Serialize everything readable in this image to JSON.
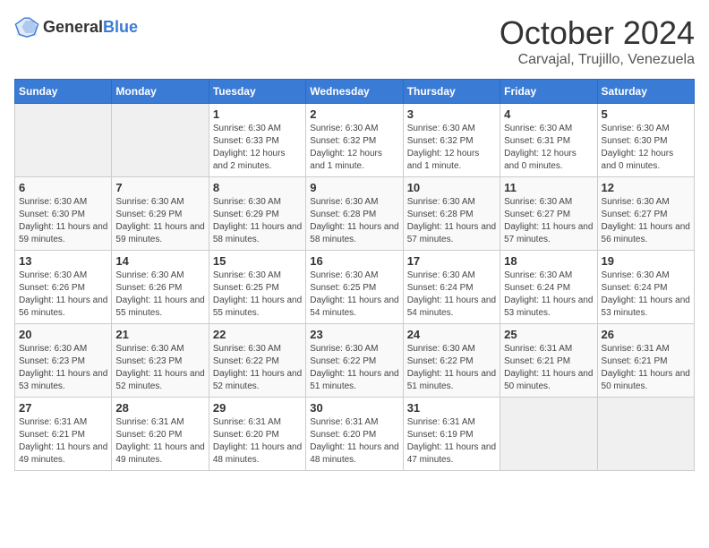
{
  "header": {
    "logo_general": "General",
    "logo_blue": "Blue",
    "month_title": "October 2024",
    "location": "Carvajal, Trujillo, Venezuela"
  },
  "days_of_week": [
    "Sunday",
    "Monday",
    "Tuesday",
    "Wednesday",
    "Thursday",
    "Friday",
    "Saturday"
  ],
  "weeks": [
    [
      {
        "day": "",
        "info": ""
      },
      {
        "day": "",
        "info": ""
      },
      {
        "day": "1",
        "info": "Sunrise: 6:30 AM\nSunset: 6:33 PM\nDaylight: 12 hours and 2 minutes."
      },
      {
        "day": "2",
        "info": "Sunrise: 6:30 AM\nSunset: 6:32 PM\nDaylight: 12 hours and 1 minute."
      },
      {
        "day": "3",
        "info": "Sunrise: 6:30 AM\nSunset: 6:32 PM\nDaylight: 12 hours and 1 minute."
      },
      {
        "day": "4",
        "info": "Sunrise: 6:30 AM\nSunset: 6:31 PM\nDaylight: 12 hours and 0 minutes."
      },
      {
        "day": "5",
        "info": "Sunrise: 6:30 AM\nSunset: 6:30 PM\nDaylight: 12 hours and 0 minutes."
      }
    ],
    [
      {
        "day": "6",
        "info": "Sunrise: 6:30 AM\nSunset: 6:30 PM\nDaylight: 11 hours and 59 minutes."
      },
      {
        "day": "7",
        "info": "Sunrise: 6:30 AM\nSunset: 6:29 PM\nDaylight: 11 hours and 59 minutes."
      },
      {
        "day": "8",
        "info": "Sunrise: 6:30 AM\nSunset: 6:29 PM\nDaylight: 11 hours and 58 minutes."
      },
      {
        "day": "9",
        "info": "Sunrise: 6:30 AM\nSunset: 6:28 PM\nDaylight: 11 hours and 58 minutes."
      },
      {
        "day": "10",
        "info": "Sunrise: 6:30 AM\nSunset: 6:28 PM\nDaylight: 11 hours and 57 minutes."
      },
      {
        "day": "11",
        "info": "Sunrise: 6:30 AM\nSunset: 6:27 PM\nDaylight: 11 hours and 57 minutes."
      },
      {
        "day": "12",
        "info": "Sunrise: 6:30 AM\nSunset: 6:27 PM\nDaylight: 11 hours and 56 minutes."
      }
    ],
    [
      {
        "day": "13",
        "info": "Sunrise: 6:30 AM\nSunset: 6:26 PM\nDaylight: 11 hours and 56 minutes."
      },
      {
        "day": "14",
        "info": "Sunrise: 6:30 AM\nSunset: 6:26 PM\nDaylight: 11 hours and 55 minutes."
      },
      {
        "day": "15",
        "info": "Sunrise: 6:30 AM\nSunset: 6:25 PM\nDaylight: 11 hours and 55 minutes."
      },
      {
        "day": "16",
        "info": "Sunrise: 6:30 AM\nSunset: 6:25 PM\nDaylight: 11 hours and 54 minutes."
      },
      {
        "day": "17",
        "info": "Sunrise: 6:30 AM\nSunset: 6:24 PM\nDaylight: 11 hours and 54 minutes."
      },
      {
        "day": "18",
        "info": "Sunrise: 6:30 AM\nSunset: 6:24 PM\nDaylight: 11 hours and 53 minutes."
      },
      {
        "day": "19",
        "info": "Sunrise: 6:30 AM\nSunset: 6:24 PM\nDaylight: 11 hours and 53 minutes."
      }
    ],
    [
      {
        "day": "20",
        "info": "Sunrise: 6:30 AM\nSunset: 6:23 PM\nDaylight: 11 hours and 53 minutes."
      },
      {
        "day": "21",
        "info": "Sunrise: 6:30 AM\nSunset: 6:23 PM\nDaylight: 11 hours and 52 minutes."
      },
      {
        "day": "22",
        "info": "Sunrise: 6:30 AM\nSunset: 6:22 PM\nDaylight: 11 hours and 52 minutes."
      },
      {
        "day": "23",
        "info": "Sunrise: 6:30 AM\nSunset: 6:22 PM\nDaylight: 11 hours and 51 minutes."
      },
      {
        "day": "24",
        "info": "Sunrise: 6:30 AM\nSunset: 6:22 PM\nDaylight: 11 hours and 51 minutes."
      },
      {
        "day": "25",
        "info": "Sunrise: 6:31 AM\nSunset: 6:21 PM\nDaylight: 11 hours and 50 minutes."
      },
      {
        "day": "26",
        "info": "Sunrise: 6:31 AM\nSunset: 6:21 PM\nDaylight: 11 hours and 50 minutes."
      }
    ],
    [
      {
        "day": "27",
        "info": "Sunrise: 6:31 AM\nSunset: 6:21 PM\nDaylight: 11 hours and 49 minutes."
      },
      {
        "day": "28",
        "info": "Sunrise: 6:31 AM\nSunset: 6:20 PM\nDaylight: 11 hours and 49 minutes."
      },
      {
        "day": "29",
        "info": "Sunrise: 6:31 AM\nSunset: 6:20 PM\nDaylight: 11 hours and 48 minutes."
      },
      {
        "day": "30",
        "info": "Sunrise: 6:31 AM\nSunset: 6:20 PM\nDaylight: 11 hours and 48 minutes."
      },
      {
        "day": "31",
        "info": "Sunrise: 6:31 AM\nSunset: 6:19 PM\nDaylight: 11 hours and 47 minutes."
      },
      {
        "day": "",
        "info": ""
      },
      {
        "day": "",
        "info": ""
      }
    ]
  ]
}
